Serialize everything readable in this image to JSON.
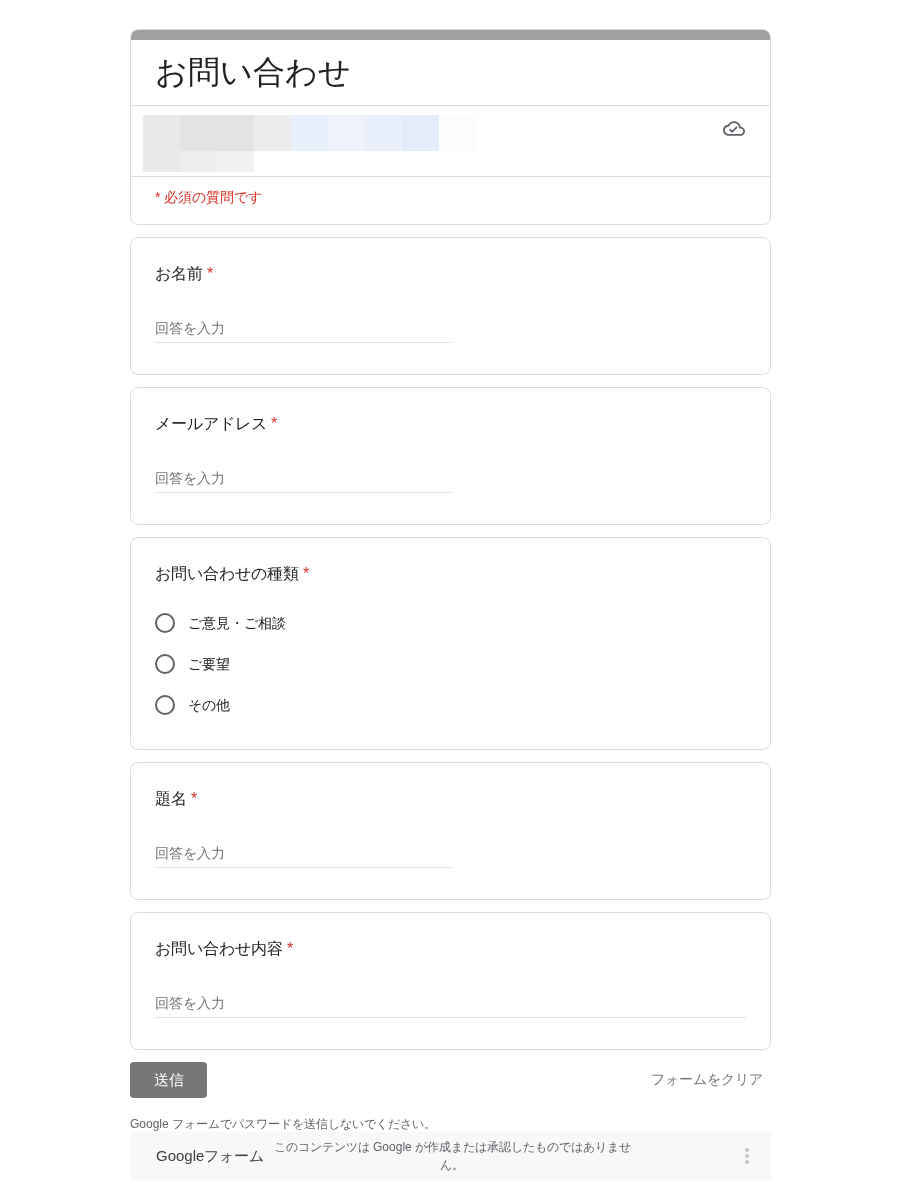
{
  "form": {
    "title": "お問い合わせ",
    "required_note": "* 必須の質問です"
  },
  "questions": [
    {
      "kind": "short",
      "label": "お名前",
      "required_mark": "*",
      "placeholder": "回答を入力"
    },
    {
      "kind": "short",
      "label": "メールアドレス",
      "required_mark": "*",
      "placeholder": "回答を入力"
    },
    {
      "kind": "choice",
      "label": "お問い合わせの種類",
      "required_mark": "*",
      "options": [
        {
          "label": "ご意見・ご相談",
          "selected": false
        },
        {
          "label": "ご要望",
          "selected": false
        },
        {
          "label": "その他",
          "selected": false
        }
      ]
    },
    {
      "kind": "short",
      "label": "題名",
      "required_mark": "*",
      "placeholder": "回答を入力"
    },
    {
      "kind": "paragraph",
      "label": "お問い合わせ内容",
      "required_mark": "*",
      "placeholder": "回答を入力"
    }
  ],
  "actions": {
    "submit": "送信",
    "clear": "フォームをクリア"
  },
  "password_warning": "Google フォームでパスワードを送信しないでください。",
  "footer": {
    "brand": "Googleフォーム",
    "disclaimer": "このコンテンツは Google が作成または承認したものではありません。"
  }
}
